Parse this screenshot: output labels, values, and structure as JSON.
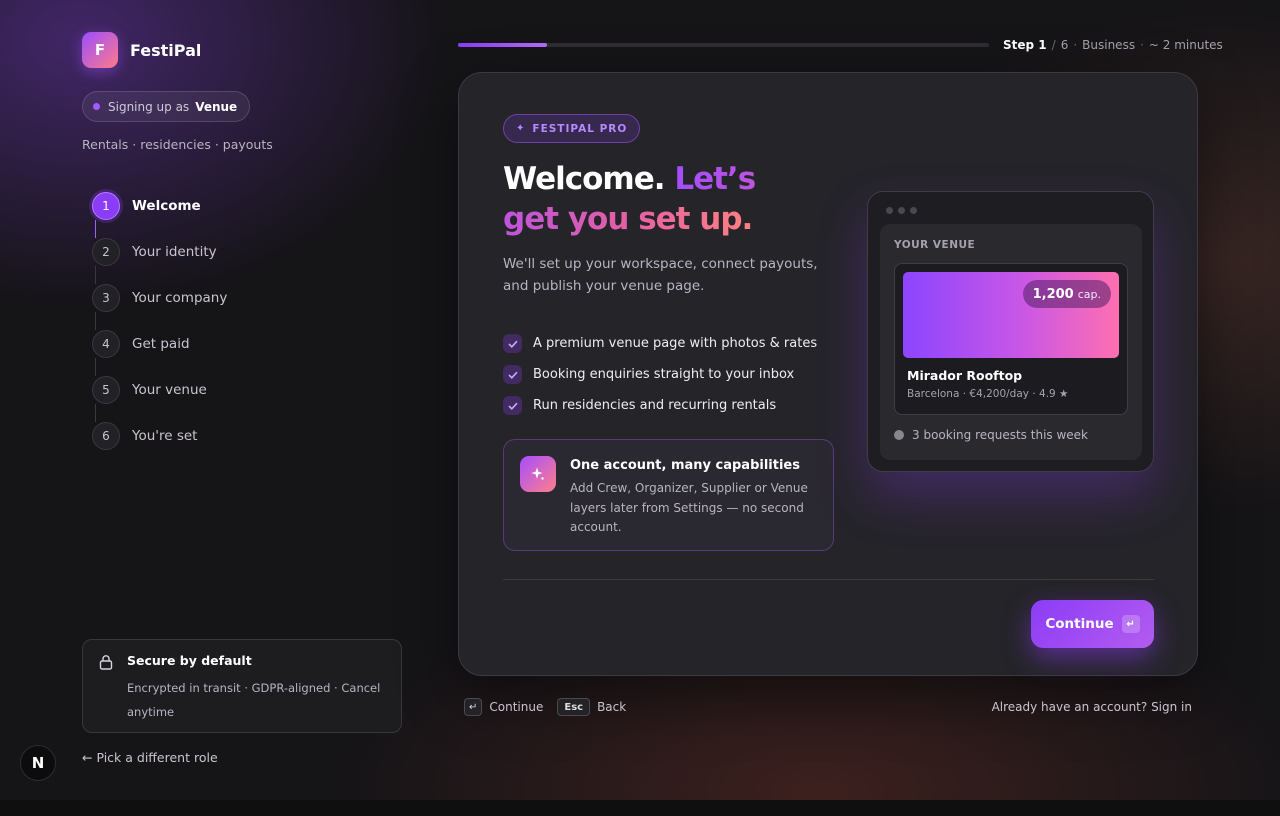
{
  "brand": {
    "logo_letter": "F",
    "name": "FestiPal"
  },
  "role_chip": {
    "prefix": "Signing up as",
    "role": "Venue"
  },
  "role_description": "Rentals · residencies · payouts",
  "steps": [
    {
      "number": "1",
      "label": "Welcome"
    },
    {
      "number": "2",
      "label": "Your identity"
    },
    {
      "number": "3",
      "label": "Your company"
    },
    {
      "number": "4",
      "label": "Get paid"
    },
    {
      "number": "5",
      "label": "Your venue"
    },
    {
      "number": "6",
      "label": "You're set"
    }
  ],
  "progress": {
    "fraction": 0.167,
    "step_label": "Step 1",
    "total": "6",
    "category": "Business",
    "duration": "~ 2 minutes",
    "separator": "/",
    "dot": "·"
  },
  "card": {
    "badge": {
      "icon": "sparkle",
      "text": "FESTIPAL PRO"
    },
    "headline_white": "Welcome.",
    "headline_gradient": "Let’s get you set up.",
    "intro": "We'll set up your workspace, connect payouts, and publish your venue page.",
    "features": [
      "A premium venue page with photos & rates",
      "Booking enquiries straight to your inbox",
      "Run residencies and recurring rentals"
    ],
    "info": {
      "icon": "sparkle-icon",
      "title": "One account, many capabilities",
      "text": "Add Crew, Organizer, Supplier or Venue layers later from Settings — no second account."
    },
    "preview": {
      "label": "YOUR VENUE",
      "capacity_value": "1,200",
      "capacity_unit": "cap.",
      "venue_name": "Mirador Rooftop",
      "venue_meta": "Barcelona · €4,200/day · 4.9 ★",
      "booking_text": "3 booking requests this week"
    },
    "continue_label": "Continue",
    "enter_key_glyph": "↵"
  },
  "footer": {
    "hints": [
      {
        "key": "↵",
        "label": "Continue"
      },
      {
        "key": "Esc",
        "label": "Back"
      }
    ],
    "signin": "Already have an account? Sign in"
  },
  "secure": {
    "title": "Secure by default",
    "text": "Encrypted in transit · GDPR-aligned · Cancel anytime"
  },
  "pick_role": "← Pick a different role",
  "n_badge": "N",
  "colors": {
    "accent": "#8b3cf7",
    "gradient_end": "#ff7f8a",
    "background": "#151417",
    "card": "#252429"
  }
}
